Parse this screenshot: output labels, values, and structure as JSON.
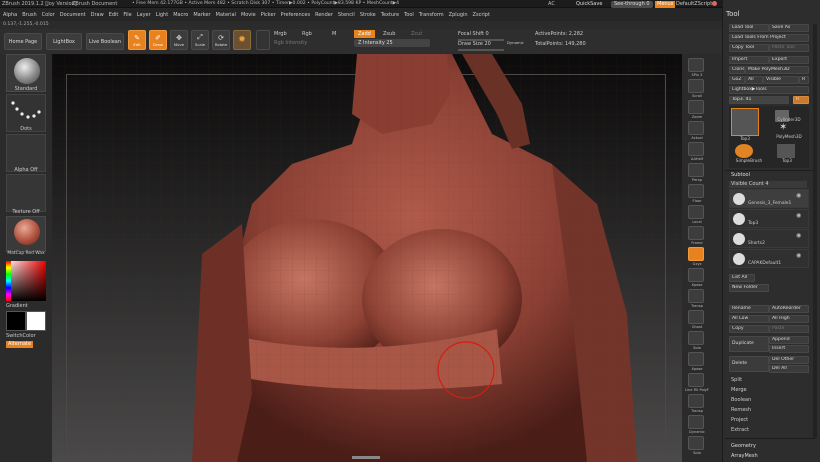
{
  "title_bar": {
    "app": "ZBrush 2019.1.2 [Joy Version]",
    "doc": "ZBrush Document",
    "stats": "• Free Mem 42.177GB • Active Mem 482 • Scratch Disk 307 • Timer▶0.002 • PolyCount▶83.598 KP • MeshCount▶4",
    "ac": "AC",
    "quicksave": "QuickSave",
    "seethrough": "See-through 0",
    "menus_btn": "Menus",
    "defaultscript": "DefaultZScript"
  },
  "menu_items": [
    "Alpha",
    "Brush",
    "Color",
    "Document",
    "Draw",
    "Edit",
    "File",
    "Layer",
    "Light",
    "Macro",
    "Marker",
    "Material",
    "Movie",
    "Picker",
    "Preferences",
    "Render",
    "Stencil",
    "Stroke",
    "Texture",
    "Tool",
    "Transform",
    "Zplugin",
    "Zscript"
  ],
  "coords": "0.137,-1.255,-0.015",
  "top_shelf": {
    "home": "Home Page",
    "lightbox": "LightBox",
    "liveboolean": "Live Boolean",
    "edit": "Edit",
    "draw": "Draw",
    "move": "Move",
    "scale": "Scale",
    "rotate": "Rotate",
    "mrgb": "Mrgb",
    "rgb": "Rgb",
    "m": "M",
    "rgb_intensity": "Rgb Intensity",
    "zadd": "Zadd",
    "zsub": "Zsub",
    "zcut": "Zcut",
    "z_intensity": "Z Intensity 25",
    "focal_shift": "Focal Shift 0",
    "draw_size": "Draw Size 20",
    "dynamic": "Dynamic",
    "active_points": "ActivePoints: 2,282",
    "total_points": "TotalPoints: 149,280"
  },
  "left_shelf": {
    "standard": "Standard",
    "dots": "Dots",
    "alpha_off": "Alpha Off",
    "texture_off": "Texture Off",
    "material": "MatCap Red Wax",
    "gradient": "Gradient",
    "switchcolor": "SwitchColor",
    "alternate": "Alternate"
  },
  "right_shelf": [
    "SPix 3",
    "Scroll",
    "Zoom",
    "Actual",
    "AAHalf",
    "Persp",
    "Floor",
    "Local",
    "Frame",
    "Gxyz",
    "Xpose",
    "Transp",
    "Ghost",
    "Solo",
    "Xpose",
    "Line Fill PolyF",
    "Transp",
    "Dynamic",
    "Solo"
  ],
  "tray": {
    "header": "Tool",
    "load_tool": "Load Tool",
    "save_as": "Save As",
    "load_from_project": "Load Tools From Project",
    "copy_tool": "Copy Tool",
    "paste_tool": "Paste Tool",
    "import": "Import",
    "export": "Export",
    "clone": "Clone",
    "make_polymesh": "Make PolyMesh3D",
    "goz": "GoZ",
    "all": "All",
    "visible": "Visible",
    "r": "R",
    "lightbox_tools": "Lightbox▶Tools",
    "top3_slider": "Top3. 41",
    "thumbs": [
      "Top3",
      "Cylinder3D",
      "SimpleBrush",
      "PolyMesh3D",
      "Top3"
    ],
    "subtool": "Subtool",
    "visible_count": "Visible Count 4",
    "subtools": [
      "Genesis_3_Female1",
      "Top3",
      "Shorts2",
      "CAPAKDefault1"
    ],
    "list_all": "List All",
    "new_folder": "New Folder",
    "rename": "Rename",
    "autoreorder": "AutoReorder",
    "all_low": "All Low",
    "all_high": "All High",
    "copy": "Copy",
    "paste": "Paste",
    "duplicate": "Duplicate",
    "append": "Append",
    "insert": "Insert",
    "delete": "Delete",
    "del_other": "Del Other",
    "del_all": "Del All",
    "split": "Split",
    "merge": "Merge",
    "boolean": "Boolean",
    "remesh": "Remesh",
    "project": "Project",
    "extract": "Extract",
    "geometry": "Geometry",
    "arraymesh": "ArrayMesh"
  }
}
